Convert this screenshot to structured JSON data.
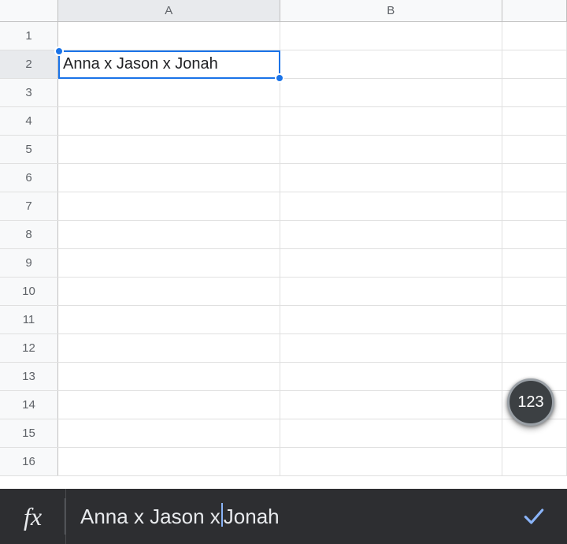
{
  "columns": [
    "A",
    "B"
  ],
  "row_count": 16,
  "active_cell": {
    "row": 2,
    "col": "A"
  },
  "cells": {
    "A2": "Anna x Jason x Jonah"
  },
  "formula_bar": {
    "fx_label": "fx",
    "value_before_caret": "Anna x Jason x ",
    "value_after_caret": "Jonah"
  },
  "fab_label": "123"
}
